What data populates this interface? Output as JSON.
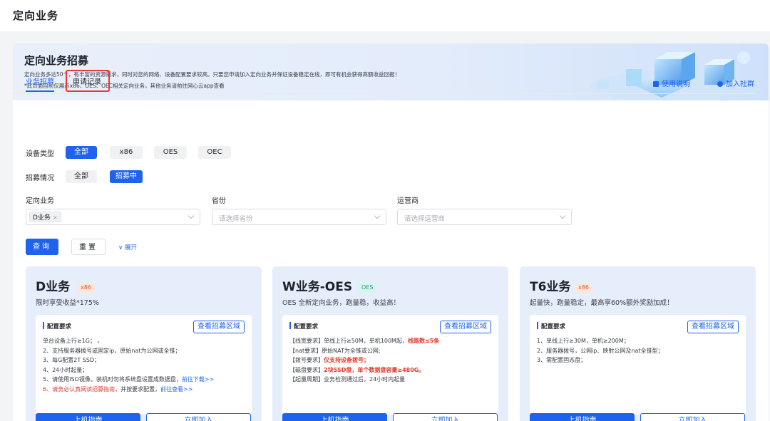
{
  "page_title": "定向业务",
  "banner": {
    "title": "定向业务招募",
    "desc": "定向业务多达50个，有丰富的资源需求，同时对您的网络、设备配置要求较高。只要您申请加入定向业务并保证设备稳定在线，即可有机会获得高额收益回报！",
    "note": "*此页面目前仅展示x86、OES、OEC相关定向业务，其他业务请前往网心云app查看"
  },
  "tabs": [
    "业务招募",
    "申请记录"
  ],
  "links": {
    "help": "使用说明",
    "community": "加入社群"
  },
  "filters": {
    "device_type": {
      "label": "设备类型",
      "options": [
        "全部",
        "x86",
        "OES",
        "OEC"
      ],
      "selected": "全部"
    },
    "recruit_status": {
      "label": "招募情况",
      "options": [
        "全部",
        "招募中"
      ],
      "selected": "招募中"
    }
  },
  "selects": [
    {
      "label": "定向业务",
      "value_tag": "D业务",
      "placeholder": ""
    },
    {
      "label": "省份",
      "value_tag": "",
      "placeholder": "请选择省份"
    },
    {
      "label": "运营商",
      "value_tag": "",
      "placeholder": "请选择运营商"
    }
  ],
  "actions": {
    "query": "查询",
    "reset": "重置",
    "expand": "展开"
  },
  "cards": [
    {
      "name": "D业务",
      "badge": "x86",
      "subtitle": "限时享受收益*175%",
      "section_title": "配置要求",
      "view_btn": "查看招募区域",
      "lines": [
        [
          {
            "t": "单台设备上行≥1G； 。"
          }
        ],
        [
          {
            "t": "2、支持服务器拨号或固定ip，原始nat为公网或全锥；"
          }
        ],
        [
          {
            "t": "3、每G配置2T SSD；"
          }
        ],
        [
          {
            "t": "4、24小时起量；"
          }
        ],
        [
          {
            "t": "5、请使用ISO镜像，装机时勿将系统盘设置成数据盘，"
          },
          {
            "t": "前往下载>>",
            "c": "blue"
          }
        ],
        [
          {
            "t": "6、",
            "c": "redn"
          },
          {
            "t": "请务必认真阅读招募指南",
            "c": "redn"
          },
          {
            "t": "，并按要求配置，"
          },
          {
            "t": "前往查看>>",
            "c": "blue"
          }
        ]
      ],
      "btn_primary": "上机指南",
      "btn_secondary": "立即加入"
    },
    {
      "name": "W业务-OES",
      "badge": "OES",
      "subtitle": "OES 全新定向业务，跑量稳，收益高！",
      "section_title": "配置要求",
      "view_btn": "查看招募区域",
      "lines": [
        [
          {
            "t": "【线宽要求】单线上行≥50M，单机100M起，"
          },
          {
            "t": "线路数≤5条",
            "c": "red"
          }
        ],
        [
          {
            "t": "【nat要求】原始NAT为全锥或公网;"
          }
        ],
        [
          {
            "t": "【拨号要求】"
          },
          {
            "t": "仅支持设备拨号；",
            "c": "red"
          }
        ],
        [
          {
            "t": "【磁盘要求】"
          },
          {
            "t": "2块SSD盘，单个数据盘容量≥480G。",
            "c": "red"
          }
        ],
        [
          {
            "t": "【起量周期】业务检测通过后，24小时内起量"
          }
        ]
      ],
      "btn_primary": "上机指南",
      "btn_secondary": "立即加入"
    },
    {
      "name": "T6业务",
      "badge": "x86",
      "subtitle": "起量快，跑量稳定，最高享60%额外奖励加成！",
      "section_title": "配置要求",
      "view_btn": "查看招募区域",
      "lines": [
        [
          {
            "t": "1、单线上行≥30M，单机≥200M；"
          }
        ],
        [
          {
            "t": "2、服务器拨号，公网ip、映射公网及nat全锥型；"
          }
        ],
        [
          {
            "t": "3、需配置固态盘；"
          }
        ]
      ],
      "btn_primary": "上机指南",
      "btn_secondary": "立即加入"
    }
  ],
  "colors": {
    "accent": "#1d63ed",
    "danger": "#e23b2e",
    "card_bg": "#e6eefc"
  }
}
